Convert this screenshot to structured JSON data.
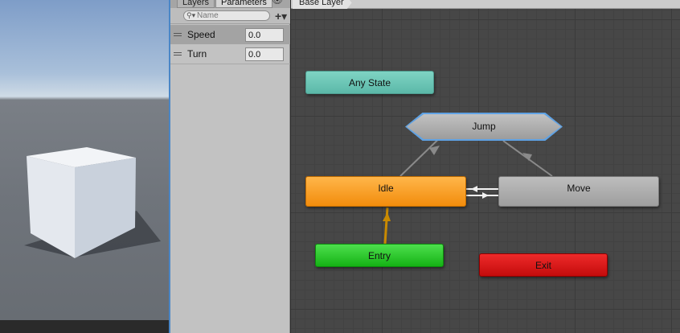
{
  "panel": {
    "tabs": [
      "Layers",
      "Parameters"
    ],
    "search_placeholder": "Name",
    "parameters": [
      {
        "name": "Speed",
        "value": "0.0",
        "selected": true
      },
      {
        "name": "Turn",
        "value": "0.0",
        "selected": false
      }
    ]
  },
  "graph": {
    "breadcrumb": "Base Layer",
    "nodes": {
      "any_state": "Any State",
      "jump": "Jump",
      "idle": "Idle",
      "move": "Move",
      "entry": "Entry",
      "exit": "Exit"
    }
  },
  "colors": {
    "any_state": "#6cc7b7",
    "idle": "#f7a02a",
    "move": "#a8a8a8",
    "entry": "#2cc92c",
    "exit": "#d91414",
    "jump_selection": "#5fa2e4",
    "default_transition": "#f0a020"
  },
  "icons": [
    "eye-icon",
    "search-icon",
    "add-icon",
    "drag-handle-icon"
  ]
}
